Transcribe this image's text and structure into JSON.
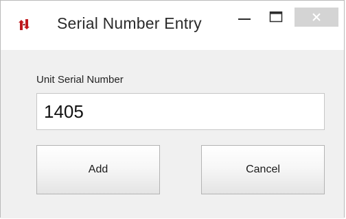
{
  "window": {
    "title": "Serial Number Entry",
    "icon": "red-arrows-app-icon",
    "controls": {
      "minimize_icon": "minimize-icon",
      "maximize_icon": "maximize-icon",
      "close_icon": "close-icon"
    }
  },
  "form": {
    "field_label": "Unit Serial Number",
    "serial_value": "1405"
  },
  "buttons": {
    "add_label": "Add",
    "cancel_label": "Cancel"
  },
  "colors": {
    "app_icon": "#c0181d",
    "close_button_bg": "#d4d4d4"
  }
}
